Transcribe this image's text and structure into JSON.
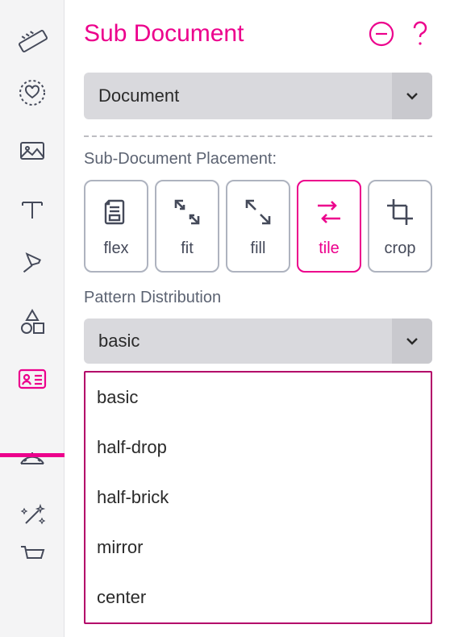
{
  "header": {
    "title": "Sub Document"
  },
  "document_select": {
    "value": "Document"
  },
  "placement": {
    "section_label": "Sub-Document Placement:",
    "options": [
      {
        "label": "flex"
      },
      {
        "label": "fit"
      },
      {
        "label": "fill"
      },
      {
        "label": "tile"
      },
      {
        "label": "crop"
      }
    ],
    "active": "tile"
  },
  "pattern": {
    "section_label": "Pattern Distribution",
    "value": "basic",
    "options": [
      {
        "label": "basic"
      },
      {
        "label": "half-drop"
      },
      {
        "label": "half-brick"
      },
      {
        "label": "mirror"
      },
      {
        "label": "center"
      }
    ]
  },
  "colors": {
    "accent": "#ec008c"
  }
}
